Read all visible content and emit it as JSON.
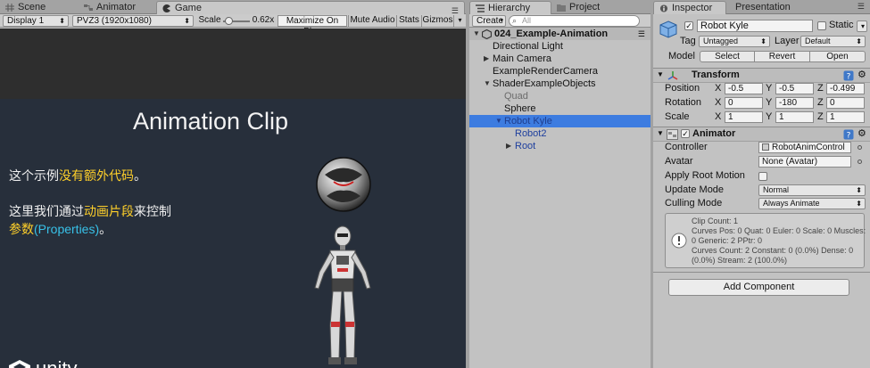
{
  "tabs": {
    "scene": "Scene",
    "animator": "Animator",
    "game": "Game",
    "hierarchy": "Hierarchy",
    "project": "Project",
    "inspector": "Inspector",
    "presentation": "Presentation"
  },
  "game_toolbar": {
    "display": "Display 1",
    "resolution": "PVZ3 (1920x1080)",
    "scale_label": "Scale",
    "scale_value": "0.62x",
    "scale_level": 0.08,
    "maximize_on_play": "Maximize On Play",
    "mute_audio": "Mute Audio",
    "stats": "Stats",
    "gizmos": "Gizmos"
  },
  "game_view": {
    "title": "Animation Clip",
    "line1_a": "这个示例",
    "line1_b": "没有额外代码",
    "line1_c": "。",
    "line2_a": "这里我们通过",
    "line2_b": "动画片段",
    "line2_c": "来控制",
    "line3_a": "参数",
    "line3_b": "(Properties)",
    "line3_c": "。",
    "logo_text": "unity"
  },
  "hierarchy": {
    "create": "Create",
    "search_placeholder": "All",
    "scene": "024_Example-Animation",
    "items": [
      {
        "label": "Directional Light"
      },
      {
        "label": "Main Camera"
      },
      {
        "label": "ExampleRenderCamera"
      },
      {
        "label": "ShaderExampleObjects"
      },
      {
        "label": "Quad"
      },
      {
        "label": "Sphere"
      },
      {
        "label": "Robot Kyle"
      },
      {
        "label": "Robot2"
      },
      {
        "label": "Root"
      }
    ]
  },
  "inspector": {
    "object_name": "Robot Kyle",
    "static": "Static",
    "tag_label": "Tag",
    "tag_value": "Untagged",
    "layer_label": "Layer",
    "layer_value": "Default",
    "model_label": "Model",
    "model_select": "Select",
    "model_revert": "Revert",
    "model_open": "Open",
    "transform": {
      "title": "Transform",
      "position_label": "Position",
      "rotation_label": "Rotation",
      "scale_label": "Scale",
      "x": "X",
      "y": "Y",
      "z": "Z",
      "position": [
        "-0.5",
        "-0.5",
        "-0.499"
      ],
      "rotation": [
        "0",
        "-180",
        "0"
      ],
      "scale": [
        "1",
        "1",
        "1"
      ]
    },
    "animator": {
      "title": "Animator",
      "controller_label": "Controller",
      "controller_value": "RobotAnimControl",
      "avatar_label": "Avatar",
      "avatar_value": "None (Avatar)",
      "apply_root_motion_label": "Apply Root Motion",
      "update_mode_label": "Update Mode",
      "update_mode_value": "Normal",
      "culling_mode_label": "Culling Mode",
      "culling_mode_value": "Always Animate",
      "info": [
        "Clip Count: 1",
        "Curves Pos: 0 Quat: 0 Euler: 0 Scale: 0 Muscles:",
        "0 Generic: 2 PPtr: 0",
        "Curves Count: 2 Constant: 0 (0.0%) Dense: 0",
        "(0.0%) Stream: 2 (100.0%)"
      ]
    },
    "add_component": "Add Component"
  },
  "colors": {
    "selection": "#3d7ce0",
    "highlight_yellow": "#ffd02a",
    "highlight_cyan": "#38c1e8",
    "scene_bg": "#272f3b"
  }
}
